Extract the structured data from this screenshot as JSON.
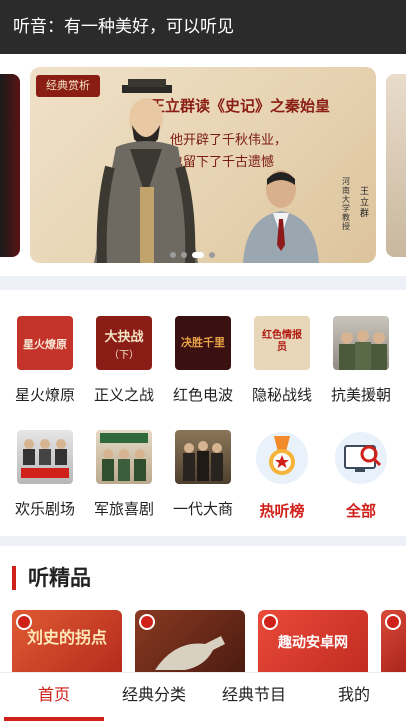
{
  "header": {
    "title": "听音：有一种美好，可以听见"
  },
  "banner": {
    "badge": "经典赏析",
    "title": "王立群读《史记》之秦始皇",
    "sub1": "他开辟了千秋伟业，",
    "sub2": "也留下了千古遗憾",
    "note": "河南大学教授",
    "name": "王立群",
    "slides": 4,
    "active_slide": 2
  },
  "categories": [
    {
      "label": "星火燎原",
      "thumb_text": "星火燎原",
      "bg": "#c4332a",
      "fg": "#f6e7d5"
    },
    {
      "label": "正义之战",
      "thumb_text": "大抉战",
      "bg": "#8c1d16",
      "fg": "#f3e3c5"
    },
    {
      "label": "红色电波",
      "thumb_text": "决胜千里",
      "bg": "#3a1010",
      "fg": "#e8a24a"
    },
    {
      "label": "隐秘战线",
      "thumb_text": "红色情报员",
      "bg": "#e7d6b8",
      "fg": "#b01a12"
    },
    {
      "label": "抗美援朝",
      "thumb_text": "",
      "bg": "#b8b3ac",
      "fg": "#d0201a"
    },
    {
      "label": "欢乐剧场",
      "thumb_text": "",
      "bg": "#d9d9d9",
      "fg": "#d0201a"
    },
    {
      "label": "军旅喜剧",
      "thumb_text": "",
      "bg": "#d6c9b6",
      "fg": "#d0201a"
    },
    {
      "label": "一代大商",
      "thumb_text": "",
      "bg": "#6b5a45",
      "fg": "#ffffff"
    },
    {
      "label": "热听榜",
      "icon": "medal-icon",
      "red": true
    },
    {
      "label": "全部",
      "icon": "search-monitor-icon",
      "red": true
    }
  ],
  "section": {
    "title": "听精品"
  },
  "cards": [
    {
      "text": "刘史的拐点",
      "bg": "#d9452c",
      "fg": "#ffe9b8"
    },
    {
      "text": "",
      "bg": "#7a2a1a",
      "fg": "#ffffff"
    },
    {
      "text": "趣动安卓网",
      "bg": "#d83a2e",
      "fg": "#ffffff"
    },
    {
      "text": "",
      "bg": "#c8372c",
      "fg": "#ffffff"
    }
  ],
  "tabs": [
    {
      "label": "首页",
      "active": true
    },
    {
      "label": "经典分类"
    },
    {
      "label": "经典节目"
    },
    {
      "label": "我的"
    }
  ],
  "colors": {
    "accent": "#d0201a",
    "header_bg": "#2b2b2b"
  }
}
